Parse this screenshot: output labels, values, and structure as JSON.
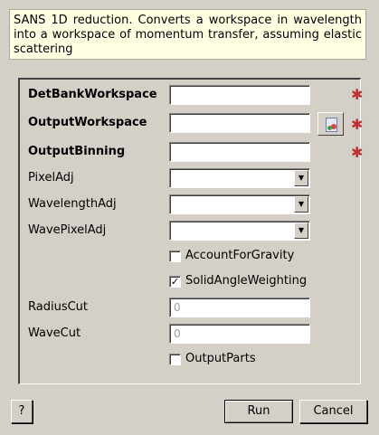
{
  "description": "SANS 1D reduction. Converts a workspace in wavelength into a workspace of momentum transfer, assuming elastic scattering",
  "fields": {
    "det_bank_workspace": {
      "label": "DetBankWorkspace",
      "value": ""
    },
    "output_workspace": {
      "label": "OutputWorkspace",
      "value": ""
    },
    "output_binning": {
      "label": "OutputBinning",
      "value": ""
    },
    "pixel_adj": {
      "label": "PixelAdj",
      "value": ""
    },
    "wavelength_adj": {
      "label": "WavelengthAdj",
      "value": ""
    },
    "wave_pixel_adj": {
      "label": "WavePixelAdj",
      "value": ""
    },
    "account_for_gravity": {
      "label": "AccountForGravity",
      "checked": false
    },
    "solid_angle_weighting": {
      "label": "SolidAngleWeighting",
      "checked": true,
      "mark": "✓"
    },
    "radius_cut": {
      "label": "RadiusCut",
      "placeholder": "0"
    },
    "wave_cut": {
      "label": "WaveCut",
      "placeholder": "0"
    },
    "output_parts": {
      "label": "OutputParts",
      "checked": false
    }
  },
  "required_mark": "✱",
  "icons": {
    "dropdown": "chevron-down-icon",
    "browse": "workspace-browse-icon",
    "required": "asterisk-icon"
  },
  "buttons": {
    "help": "?",
    "run": "Run",
    "cancel": "Cancel"
  }
}
